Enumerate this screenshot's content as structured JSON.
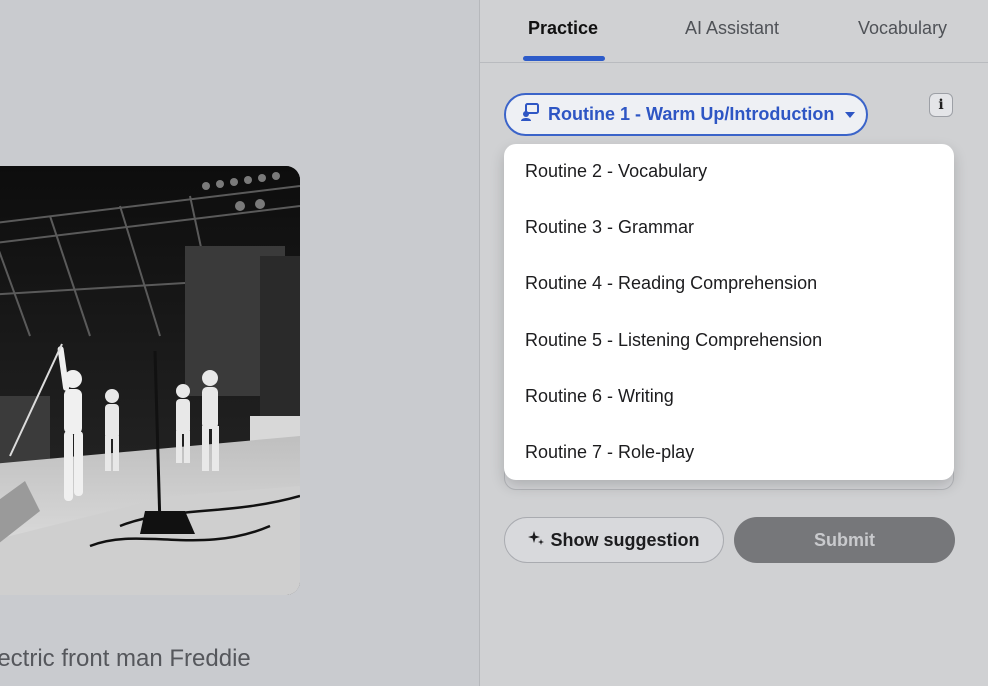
{
  "caption": "lectric front man Freddie",
  "tabs": [
    {
      "label": "Practice",
      "active": true
    },
    {
      "label": "AI Assistant",
      "active": false
    },
    {
      "label": "Vocabulary",
      "active": false
    }
  ],
  "routine_select": {
    "label": "Routine 1 - Warm Up/Introduction",
    "icon": "presenter-icon",
    "caret_icon": "caret-down-icon"
  },
  "info_button": {
    "label": "i"
  },
  "dropdown": {
    "items": [
      "Routine 2 - Vocabulary",
      "Routine 3 - Grammar",
      "Routine 4 - Reading Comprehension",
      "Routine 5 - Listening Comprehension",
      "Routine 6 - Writing",
      "Routine 7 - Role-play"
    ]
  },
  "actions": {
    "suggest_label": "Show suggestion",
    "suggest_icon": "sparkle-icon",
    "submit_label": "Submit"
  },
  "colors": {
    "accent": "#2e56c4",
    "submit_bg": "#76777a"
  }
}
